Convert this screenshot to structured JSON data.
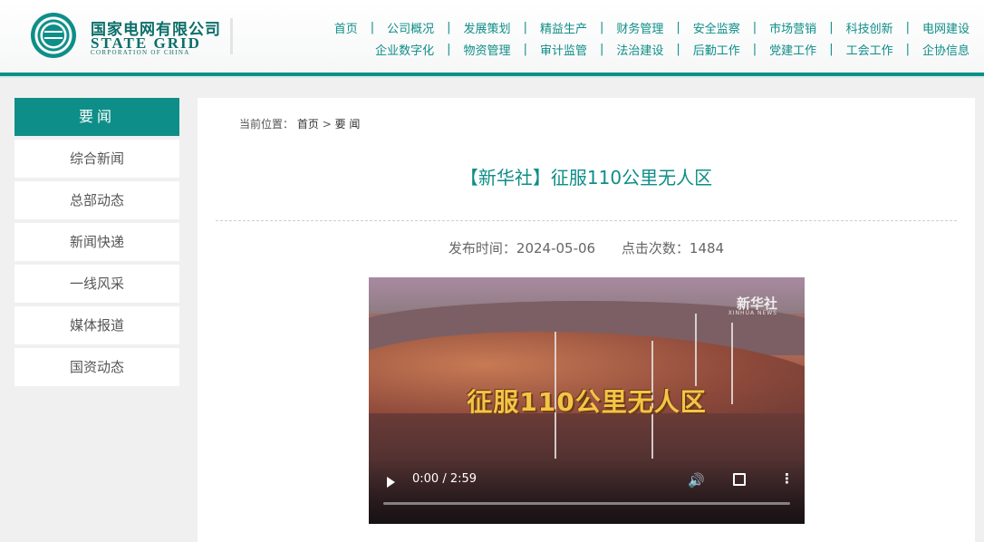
{
  "header": {
    "logo_cn": "国家电网有限公司",
    "logo_en": "STATE GRID",
    "logo_en_sub": "CORPORATION OF CHINA",
    "nav_row1": [
      "首页",
      "公司概况",
      "发展策划",
      "精益生产",
      "财务管理",
      "安全监察",
      "市场营销",
      "科技创新",
      "电网建设"
    ],
    "nav_row2": [
      "企业数字化",
      "物资管理",
      "审计监管",
      "法治建设",
      "后勤工作",
      "党建工作",
      "工会工作",
      "企协信息"
    ],
    "nav_sep": "|"
  },
  "sidebar": {
    "title": "要闻",
    "items": [
      "综合新闻",
      "总部动态",
      "新闻快递",
      "一线风采",
      "媒体报道",
      "国资动态"
    ]
  },
  "breadcrumb": {
    "label": "当前位置：",
    "home": "首页",
    "sep": ">",
    "current": "要 闻"
  },
  "article": {
    "title": "【新华社】征服110公里无人区",
    "publish_label": "发布时间：",
    "publish_date": "2024-05-06",
    "views_label": "点击次数：",
    "views": "1484"
  },
  "video": {
    "overlay_title": "征服110公里无人区",
    "watermark": "新华社",
    "watermark_en": "XINHUA NEWS",
    "time": "0:00 / 2:59",
    "progress": 0,
    "volume_icon": "🔊",
    "more_icon": "⋮"
  },
  "colors": {
    "brand": "#0e8e88",
    "title": "#0e8e88"
  }
}
